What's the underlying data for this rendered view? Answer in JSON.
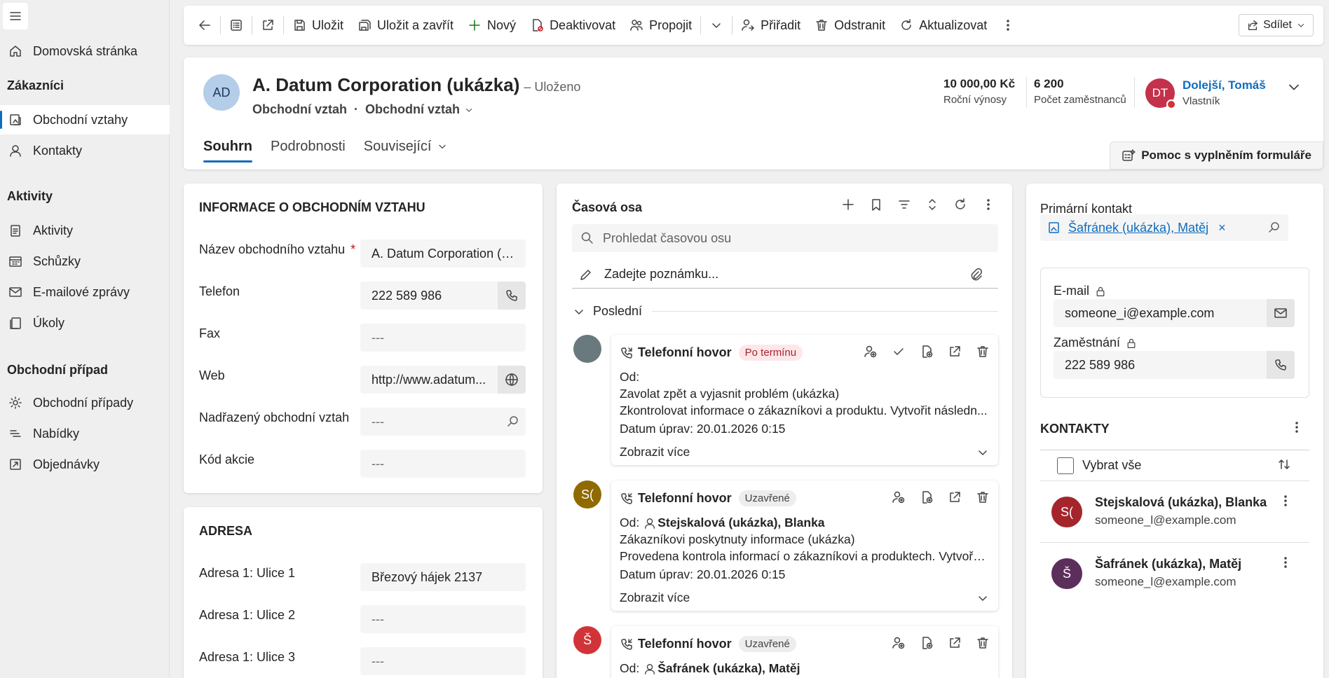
{
  "sidebar": {
    "home": "Domovská stránka",
    "groups": [
      "Zákazníci",
      "Aktivity",
      "Obchodní případ"
    ],
    "items": [
      {
        "label": "Obchodní vztahy",
        "icon": "account-icon"
      },
      {
        "label": "Kontakty",
        "icon": "person-icon"
      },
      {
        "label": "Aktivity",
        "icon": "activities-icon"
      },
      {
        "label": "Schůzky",
        "icon": "calendar-icon"
      },
      {
        "label": "E-mailové zprávy",
        "icon": "mail-icon"
      },
      {
        "label": "Úkoly",
        "icon": "tasks-icon"
      },
      {
        "label": "Obchodní případy",
        "icon": "gear-icon"
      },
      {
        "label": "Nabídky",
        "icon": "quotes-icon"
      },
      {
        "label": "Objednávky",
        "icon": "orders-icon"
      }
    ]
  },
  "commands": {
    "save": "Uložit",
    "save_close": "Uložit a zavřít",
    "new": "Nový",
    "deactivate": "Deaktivovat",
    "connect": "Propojit",
    "assign": "Přiřadit",
    "delete": "Odstranit",
    "refresh": "Aktualizovat",
    "share": "Sdílet"
  },
  "header": {
    "avatar": "AD",
    "title": "A. Datum Corporation (ukázka)",
    "saved": "– Uloženo",
    "entity": "Obchodní vztah",
    "separator": "·",
    "form": "Obchodní vztah",
    "revenue_value": "10 000,00 Kč",
    "revenue_label": "Roční výnosy",
    "employees_value": "6 200",
    "employees_label": "Počet zaměstnanců",
    "owner_initials": "DT",
    "owner_name": "Dolejší, Tomáš",
    "owner_label": "Vlastník",
    "tabs": [
      "Souhrn",
      "Podrobnosti",
      "Související"
    ],
    "assist": "Pomoc s vyplněním formuláře"
  },
  "info": {
    "title": "INFORMACE O OBCHODNÍM VZTAHU",
    "required_mark": "*",
    "fields": [
      {
        "label": "Název obchodního vztahu",
        "value": "A. Datum Corporation (u..."
      },
      {
        "label": "Telefon",
        "value": "222 589 986"
      },
      {
        "label": "Fax",
        "value": "---"
      },
      {
        "label": "Web",
        "value": "http://www.adatum..."
      },
      {
        "label": "Nadřazený obchodní vztah",
        "value": "---"
      },
      {
        "label": "Kód akcie",
        "value": "---"
      }
    ]
  },
  "address": {
    "title": "ADRESA",
    "fields": [
      {
        "label": "Adresa 1: Ulice 1",
        "value": "Březový hájek 2137"
      },
      {
        "label": "Adresa 1: Ulice 2",
        "value": "---"
      },
      {
        "label": "Adresa 1: Ulice 3",
        "value": "---"
      }
    ]
  },
  "timeline": {
    "title": "Časová osa",
    "search_placeholder": "Prohledat časovou osu",
    "note_placeholder": "Zadejte poznámku...",
    "group": "Poslední",
    "items": [
      {
        "avatar": "",
        "avatar_color": "#69797e",
        "type": "Telefonní hovor",
        "badge": "Po termínu",
        "from_label": "Od:",
        "from": "",
        "subject": "Zavolat zpět a vyjasnit problém (ukázka)",
        "body": "Zkontrolovat informace o zákazníkovi a produktu. Vytvořit následn...",
        "modified": "Datum úprav: 20.01.2026 0:15",
        "more": "Zobrazit více"
      },
      {
        "avatar": "S(",
        "avatar_color": "#8f6a00",
        "type": "Telefonní hovor",
        "badge": "Uzavřené",
        "from_label": "Od:",
        "from": "Stejskalová (ukázka), Blanka",
        "subject": "Zákazníkovi poskytnuty informace (ukázka)",
        "body": "Provedena kontrola informací o zákazníkovi a produktech. Vytvoře...",
        "modified": "Datum úprav: 20.01.2026 0:15",
        "more": "Zobrazit více"
      },
      {
        "avatar": "Š",
        "avatar_color": "#d13438",
        "type": "Telefonní hovor",
        "badge": "Uzavřené",
        "from_label": "Od:",
        "from": "Šafránek (ukázka), Matěj"
      }
    ]
  },
  "primary_contact": {
    "label": "Primární kontakt",
    "value": "Šafránek (ukázka), Matěj",
    "remove": "×",
    "email_label": "E-mail",
    "email": "someone_i@example.com",
    "phone_label": "Zaměstnání",
    "phone": "222 589 986"
  },
  "contacts": {
    "title": "KONTAKTY",
    "select_all": "Vybrat vše",
    "rows": [
      {
        "initials": "S(",
        "color": "#a4262c",
        "name": "Stejskalová (ukázka), Blanka",
        "email": "someone_l@example.com"
      },
      {
        "initials": "Š",
        "color": "#5c2e5b",
        "name": "Šafránek (ukázka), Matěj",
        "email": "someone_l@example.com"
      }
    ]
  }
}
